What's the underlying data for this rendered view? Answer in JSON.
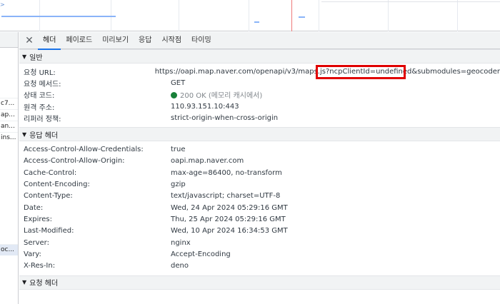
{
  "tabs": [
    {
      "label": "헤더",
      "active": true
    },
    {
      "label": "페이로드",
      "active": false
    },
    {
      "label": "미리보기",
      "active": false
    },
    {
      "label": "응답",
      "active": false
    },
    {
      "label": "시작점",
      "active": false
    },
    {
      "label": "타이밍",
      "active": false
    }
  ],
  "request_list": [
    {
      "text": "c7...",
      "selected": false
    },
    {
      "text": "ap...",
      "selected": false
    },
    {
      "text": "an...",
      "selected": false
    },
    {
      "text": "ins...",
      "selected": false
    },
    {
      "text": "oc...",
      "selected": true
    }
  ],
  "general": {
    "title": "일반",
    "rows": [
      {
        "key": "요청 URL:",
        "value": "https://oapi.map.naver.com/openapi/v3/maps.js?ncpClientId=undefined&submodules=geocoder"
      },
      {
        "key": "요청 메서드:",
        "value": "GET"
      },
      {
        "key": "상태 코드:",
        "value": "200 OK (메모리 캐시에서)",
        "status_color": "#188038"
      },
      {
        "key": "원격 주소:",
        "value": "110.93.151.10:443"
      },
      {
        "key": "리퍼러 정책:",
        "value": "strict-origin-when-cross-origin"
      }
    ]
  },
  "response_headers": {
    "title": "응답 헤더",
    "rows": [
      {
        "key": "Access-Control-Allow-Credentials:",
        "value": "true"
      },
      {
        "key": "Access-Control-Allow-Origin:",
        "value": "oapi.map.naver.com"
      },
      {
        "key": "Cache-Control:",
        "value": "max-age=86400, no-transform"
      },
      {
        "key": "Content-Encoding:",
        "value": "gzip"
      },
      {
        "key": "Content-Type:",
        "value": "text/javascript; charset=UTF-8"
      },
      {
        "key": "Date:",
        "value": "Wed, 24 Apr 2024 05:29:16 GMT"
      },
      {
        "key": "Expires:",
        "value": "Thu, 25 Apr 2024 05:29:16 GMT"
      },
      {
        "key": "Last-Modified:",
        "value": "Wed, 10 Apr 2024 16:34:53 GMT"
      },
      {
        "key": "Server:",
        "value": "nginx"
      },
      {
        "key": "Vary:",
        "value": "Accept-Encoding"
      },
      {
        "key": "X-Res-In:",
        "value": "deno"
      }
    ]
  },
  "request_headers": {
    "title": "요청 헤더"
  },
  "colors": {
    "accent": "#1a73e8",
    "highlight": "#e00000",
    "status_ok": "#188038"
  }
}
